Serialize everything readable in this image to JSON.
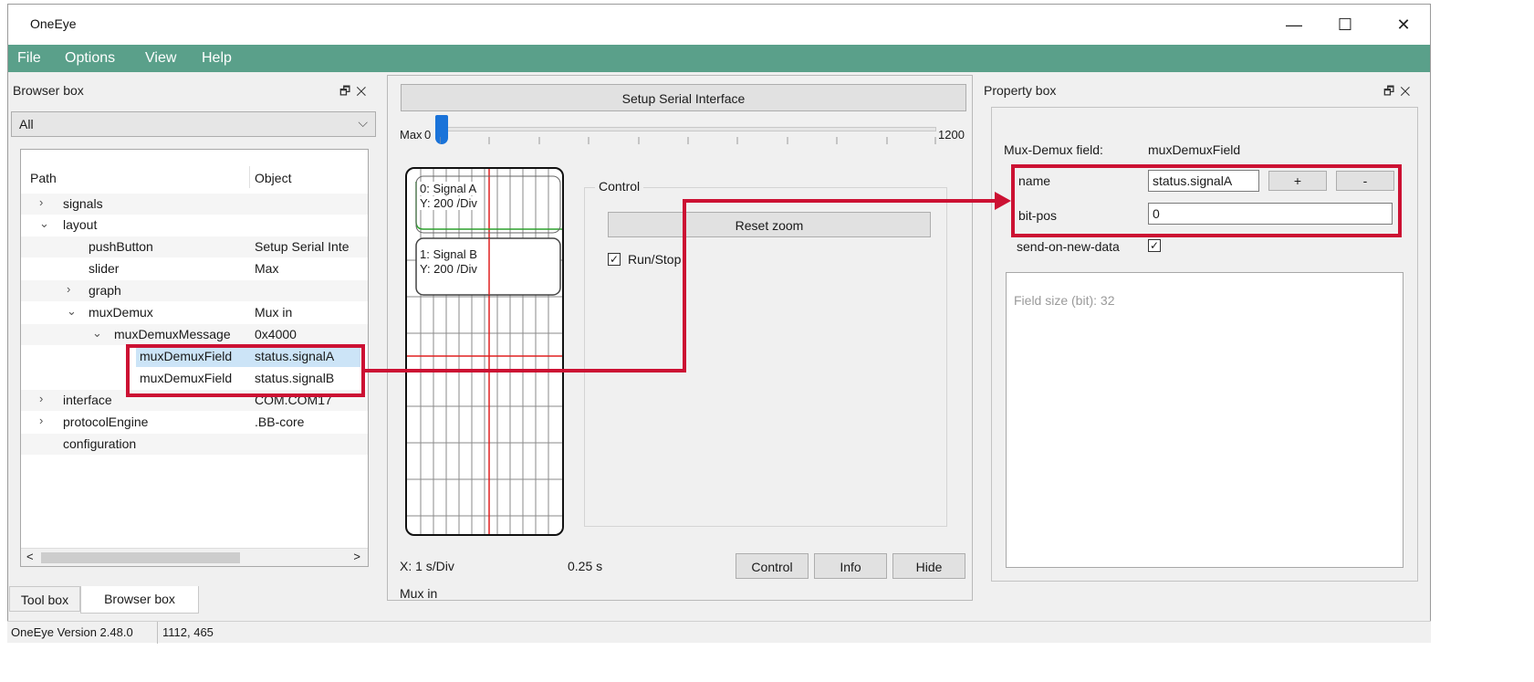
{
  "window": {
    "title": "OneEye"
  },
  "window_controls": {
    "minimize": "—",
    "maximize": "☐",
    "close": "✕"
  },
  "menu": [
    "File",
    "Options",
    "View",
    "Help"
  ],
  "browser_box": {
    "title": "Browser box",
    "filter": "All",
    "columns": [
      "Path",
      "Object"
    ],
    "rows": [
      {
        "path": "signals",
        "object": ""
      },
      {
        "path": "layout",
        "object": ""
      },
      {
        "path": "pushButton",
        "object": "Setup Serial Inte"
      },
      {
        "path": "slider",
        "object": "Max"
      },
      {
        "path": "graph",
        "object": ""
      },
      {
        "path": "muxDemux",
        "object": "Mux in"
      },
      {
        "path": "muxDemuxMessage",
        "object": "0x4000"
      },
      {
        "path": "muxDemuxField",
        "object": "status.signalA"
      },
      {
        "path": "muxDemuxField",
        "object": "status.signalB"
      },
      {
        "path": "interface",
        "object": "COM.COM17"
      },
      {
        "path": "protocolEngine",
        "object": ".BB-core"
      },
      {
        "path": "configuration",
        "object": ""
      }
    ],
    "tabs": [
      "Tool box",
      "Browser box"
    ],
    "active_tab": "Browser box"
  },
  "center": {
    "setup_button": "Setup Serial Interface",
    "slider": {
      "label": "Max",
      "min_label": "0",
      "max_label": "1200",
      "value": 0
    },
    "signals": [
      {
        "name": "0: Signal A",
        "scale": "Y: 200 /Div"
      },
      {
        "name": "1: Signal B",
        "scale": "Y: 200 /Div"
      }
    ],
    "control": {
      "group_label": "Control",
      "reset_zoom": "Reset zoom",
      "run_stop_label": "Run/Stop",
      "run_stop_checked": "✓"
    },
    "x_scale": "X: 1 s/Div",
    "time": "0.25 s",
    "buttons": [
      "Control",
      "Info",
      "Hide"
    ],
    "footer": "Mux in"
  },
  "property_box": {
    "title": "Property box",
    "field_type_label": "Mux-Demux field:",
    "field_type_value": "muxDemuxField",
    "name_label": "name",
    "name_value": "status.signalA",
    "plus_button": "+",
    "minus_button": "-",
    "bitpos_label": "bit-pos",
    "bitpos_value": "0",
    "send_label": "send-on-new-data",
    "send_checked": "✓",
    "info_text": "Field size (bit): 32"
  },
  "status": {
    "version": "OneEye Version 2.48.0",
    "coords": "1112, 465"
  },
  "icons": {
    "float": "🗗",
    "close": "✕",
    "arrow_right": "›",
    "arrow_down": "⌄",
    "combo_arrow": "⌵",
    "scroll_left": "<",
    "scroll_right": ">"
  },
  "colors": {
    "menubar": "#5aa08a",
    "highlight": "#cc1133",
    "selection": "#cce4f7",
    "signal_a": "#2ca02c",
    "signal_b": "#e02020"
  }
}
